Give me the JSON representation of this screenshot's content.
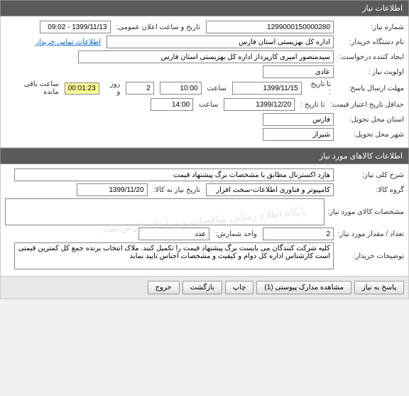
{
  "section1": {
    "title": "اطلاعات نیاز",
    "fields": {
      "need_number_label": "شماره نیاز:",
      "need_number": "1299000150000280",
      "public_datetime_label": "تاریخ و ساعت اعلان عمومی:",
      "public_datetime": "1399/11/13 - 09:02",
      "buyer_org_label": "نام دستگاه خریدار:",
      "buyer_org": "اداره کل بهزیستی استان فارس",
      "buyer_contact_link": "اطلاعات تماس خریدار",
      "requester_label": "ایجاد کننده درخواست:",
      "requester": "سیدمنصور امیری کارپرداز اداره کل بهزیستی استان فارس",
      "priority_label": "اولویت نیاز :",
      "priority": "عادی",
      "response_deadline_label": "مهلت ارسال پاسخ:",
      "until_date_label": "تا تاریخ :",
      "response_date": "1399/11/15",
      "hour_label": "ساعت",
      "response_hour": "10:00",
      "days_label": "روز و",
      "days": "2",
      "countdown": "00:01:23",
      "remaining_label": "ساعت باقی مانده",
      "price_validity_label": "حداقل تاریخ اعتبار قیمت:",
      "validity_date": "1399/12/20",
      "validity_hour": "14:00",
      "delivery_province_label": "استان محل تحویل:",
      "delivery_province": "فارس",
      "delivery_city_label": "شهر محل تحویل:",
      "delivery_city": "شیراز"
    }
  },
  "section2": {
    "title": "اطلاعات کالاهای مورد نیاز",
    "fields": {
      "general_desc_label": "شرح کلی نیاز:",
      "general_desc": "هارد اکسترنال مطابق با مشخصات برگ پیشنهاد قیمت",
      "goods_group_label": "گروه کالا:",
      "goods_group": "کامپیوتر و فناوری اطلاعات-سخت افزار",
      "need_date_label": "تاریخ نیاز به کالا:",
      "need_date": "1399/11/20",
      "goods_spec_label": "مشخصات کالای مورد نیاز:",
      "goods_spec": "",
      "qty_label": "تعداد / مقدار مورد نیاز:",
      "qty": "2",
      "unit_label": "واحد شمارش:",
      "unit": "عدد",
      "buyer_notes_label": "توضیحات خریدار:",
      "buyer_notes": "کلیه شرکت کنندگان می بایست برگ پیشنهاد قیمت را تکمیل کنند. ملاک انتخاب برنده جمع کل کمترین قیمتی است کارشناس اداره کل  دوام و کیفیت و مشخصات اجناس تایید نماید"
    }
  },
  "buttons": {
    "respond": "پاسخ به نیاز",
    "attachments": "مشاهده مدارک پیوستی (1)",
    "print": "چاپ",
    "back": "بازگشت",
    "exit": "خروج"
  }
}
